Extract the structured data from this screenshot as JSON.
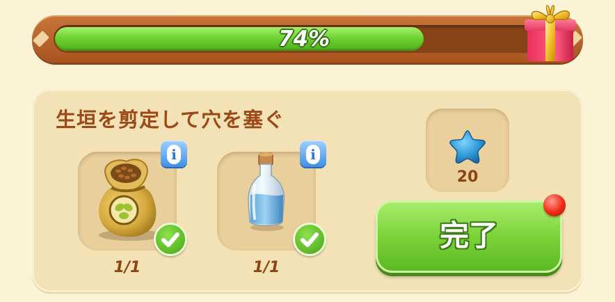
{
  "progress": {
    "percent": 74,
    "label": "74%",
    "fill_color": "#6ed331",
    "frame_color": "#b9622a",
    "reward_icon": "gift-box-icon"
  },
  "task": {
    "title": "生垣を剪定して穴を塞ぐ",
    "title_color": "#9b4a17",
    "requirements": [
      {
        "item_icon": "seed-bag-icon",
        "count": "1/1",
        "completed": true,
        "info_icon": "info-icon"
      },
      {
        "item_icon": "water-bottle-icon",
        "count": "1/1",
        "completed": true,
        "info_icon": "info-icon"
      }
    ],
    "reward": {
      "icon": "blue-star-icon",
      "amount": "20",
      "color": "#2f9ad8"
    },
    "complete_button": {
      "label": "完了",
      "color": "#7bd33a",
      "notification_icon": "red-dot-badge"
    }
  }
}
